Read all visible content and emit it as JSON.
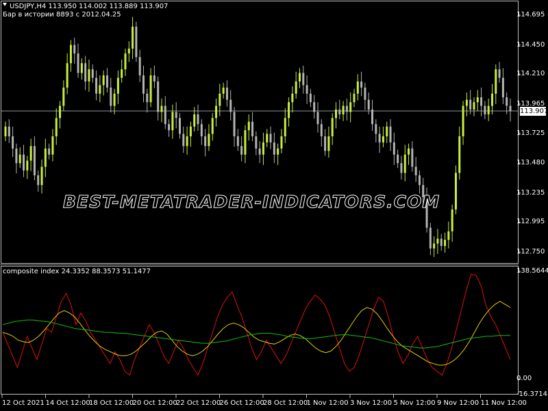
{
  "main_chart": {
    "header": "USDJPY,H4  113.950 114.002 113.889 113.907",
    "history": "Бар в истории 8893 с 2012.04.25",
    "watermark": "BEST-METATRADER-INDICATORS.COM",
    "current_price": "113.907",
    "price_labels": [
      "114.695",
      "114.450",
      "114.210",
      "113.965",
      "113.725",
      "113.480",
      "113.235",
      "112.995",
      "112.750"
    ]
  },
  "indicator": {
    "header": "composite index 24.3352 88.3573 51.1477",
    "axis_labels": [
      "138.5644",
      "0.00",
      "-16.3714"
    ]
  },
  "time_axis": [
    "12 Oct 2021",
    "14 Oct 12:00",
    "18 Oct 12:00",
    "20 Oct 12:00",
    "22 Oct 12:00",
    "26 Oct 12:00",
    "28 Oct 12:00",
    "1 Nov 12:00",
    "3 Nov 12:00",
    "5 Nov 12:00",
    "9 Nov 12:00",
    "11 Nov 12:00"
  ],
  "chart_data": [
    {
      "type": "candlestick",
      "symbol": "USDJPY",
      "timeframe": "H4",
      "ylim": [
        112.7,
        114.8
      ],
      "y_ticks": [
        114.695,
        114.45,
        114.21,
        113.965,
        113.725,
        113.48,
        113.235,
        112.995,
        112.75
      ],
      "current_price": 113.907,
      "bull_color": "#c8f03c",
      "bear_color": "#b4b4b4",
      "close": [
        113.78,
        113.7,
        113.6,
        113.48,
        113.55,
        113.42,
        113.5,
        113.62,
        113.38,
        113.3,
        113.45,
        113.6,
        113.55,
        113.7,
        113.85,
        113.95,
        114.1,
        114.3,
        114.45,
        114.38,
        114.22,
        114.3,
        114.15,
        114.25,
        114.18,
        114.05,
        114.12,
        114.2,
        114.1,
        113.95,
        114.05,
        114.18,
        114.25,
        114.38,
        114.42,
        114.6,
        114.35,
        114.2,
        114.05,
        113.98,
        114.2,
        114.15,
        113.9,
        113.95,
        113.8,
        113.75,
        113.9,
        113.85,
        113.72,
        113.62,
        113.7,
        113.78,
        113.88,
        113.8,
        113.7,
        113.62,
        113.72,
        113.85,
        113.95,
        114.05,
        114.1,
        114.0,
        113.9,
        113.7,
        113.62,
        113.55,
        113.75,
        113.82,
        113.7,
        113.6,
        113.55,
        113.65,
        113.72,
        113.65,
        113.55,
        113.6,
        113.7,
        113.85,
        113.98,
        114.05,
        114.15,
        114.22,
        114.12,
        114.05,
        113.98,
        113.9,
        113.8,
        113.7,
        113.58,
        113.7,
        113.85,
        113.92,
        113.88,
        113.95,
        113.9,
        113.98,
        114.05,
        114.15,
        114.1,
        114.0,
        113.92,
        113.8,
        113.72,
        113.65,
        113.7,
        113.78,
        113.65,
        113.55,
        113.48,
        113.4,
        113.55,
        113.6,
        113.45,
        113.38,
        113.3,
        113.2,
        112.95,
        112.78,
        112.82,
        112.86,
        112.8,
        112.85,
        112.92,
        113.1,
        113.4,
        113.7,
        113.95,
        114.0,
        113.92,
        113.98,
        114.02,
        113.95,
        113.88,
        113.95,
        114.05,
        114.25,
        114.18,
        114.02,
        113.95,
        113.907
      ],
      "open": [
        113.7,
        113.78,
        113.7,
        113.6,
        113.48,
        113.55,
        113.42,
        113.5,
        113.62,
        113.38,
        113.3,
        113.45,
        113.6,
        113.55,
        113.7,
        113.85,
        113.95,
        114.1,
        114.3,
        114.45,
        114.38,
        114.22,
        114.3,
        114.15,
        114.25,
        114.18,
        114.05,
        114.12,
        114.2,
        114.1,
        113.95,
        114.05,
        114.18,
        114.25,
        114.38,
        114.42,
        114.6,
        114.35,
        114.2,
        114.05,
        113.98,
        114.2,
        114.15,
        113.9,
        113.95,
        113.8,
        113.75,
        113.9,
        113.85,
        113.72,
        113.62,
        113.7,
        113.78,
        113.88,
        113.8,
        113.7,
        113.62,
        113.72,
        113.85,
        113.95,
        114.05,
        114.1,
        114.0,
        113.9,
        113.7,
        113.62,
        113.55,
        113.75,
        113.82,
        113.7,
        113.6,
        113.55,
        113.65,
        113.72,
        113.65,
        113.55,
        113.6,
        113.7,
        113.85,
        113.98,
        114.05,
        114.15,
        114.22,
        114.12,
        114.05,
        113.98,
        113.9,
        113.8,
        113.7,
        113.58,
        113.7,
        113.85,
        113.92,
        113.88,
        113.95,
        113.9,
        113.98,
        114.05,
        114.15,
        114.1,
        114.0,
        113.92,
        113.8,
        113.72,
        113.65,
        113.7,
        113.78,
        113.65,
        113.55,
        113.48,
        113.4,
        113.55,
        113.6,
        113.45,
        113.38,
        113.3,
        113.2,
        112.95,
        112.78,
        112.82,
        112.86,
        112.8,
        112.85,
        112.92,
        113.1,
        113.4,
        113.7,
        113.95,
        114.0,
        113.92,
        113.98,
        114.02,
        113.95,
        113.88,
        113.95,
        114.05,
        114.25,
        114.18,
        114.02,
        113.95
      ]
    },
    {
      "type": "line",
      "title": "composite index",
      "ylim": [
        -16.3714,
        138.5644
      ],
      "series": [
        {
          "name": "",
          "color": "#e01010",
          "values": [
            60,
            45,
            30,
            15,
            35,
            55,
            40,
            25,
            45,
            65,
            60,
            80,
            100,
            110,
            95,
            70,
            85,
            75,
            60,
            50,
            40,
            30,
            20,
            35,
            25,
            10,
            5,
            25,
            40,
            55,
            70,
            60,
            45,
            30,
            20,
            35,
            50,
            40,
            25,
            15,
            5,
            20,
            40,
            60,
            80,
            95,
            105,
            112,
            95,
            80,
            60,
            40,
            25,
            35,
            50,
            40,
            30,
            20,
            30,
            45,
            60,
            75,
            90,
            100,
            108,
            103,
            95,
            80,
            60,
            40,
            20,
            10,
            15,
            30,
            50,
            70,
            90,
            105,
            100,
            80,
            55,
            35,
            20,
            30,
            45,
            55,
            40,
            25,
            15,
            10,
            5,
            20,
            40,
            65,
            90,
            115,
            135,
            133,
            120,
            95,
            80,
            70,
            55,
            40,
            25
          ]
        },
        {
          "name": "",
          "color": "#e6d000",
          "values": [
            60,
            58,
            55,
            50,
            48,
            47,
            50,
            55,
            62,
            70,
            78,
            85,
            88,
            85,
            80,
            72,
            63,
            55,
            48,
            42,
            38,
            35,
            32,
            30,
            30,
            32,
            36,
            42,
            48,
            55,
            60,
            62,
            58,
            50,
            42,
            36,
            32,
            30,
            32,
            36,
            42,
            50,
            58,
            65,
            70,
            72,
            70,
            66,
            60,
            54,
            50,
            48,
            46,
            45,
            48,
            52,
            56,
            58,
            56,
            52,
            46,
            40,
            36,
            34,
            36,
            42,
            50,
            60,
            70,
            80,
            88,
            92,
            90,
            84,
            75,
            65,
            56,
            48,
            42,
            38,
            34,
            30,
            26,
            22,
            20,
            18,
            18,
            20,
            24,
            30,
            38,
            48,
            60,
            72,
            82,
            90,
            96,
            100,
            96,
            92
          ]
        },
        {
          "name": "",
          "color": "#10c010",
          "values": [
            70,
            72,
            74,
            75,
            76,
            76,
            75,
            74,
            73,
            71,
            69,
            67,
            65,
            64,
            63,
            62,
            61,
            60,
            60,
            59,
            59,
            58,
            57,
            56,
            55,
            54,
            53,
            52,
            51,
            50,
            49,
            48,
            47,
            46,
            46,
            47,
            48,
            49,
            51,
            53,
            55,
            57,
            58,
            59,
            59,
            58,
            57,
            55,
            54,
            53,
            52,
            52,
            53,
            54,
            55,
            56,
            57,
            57,
            56,
            55,
            54,
            53,
            51,
            49,
            47,
            45,
            43,
            42,
            41,
            40,
            40,
            41,
            42,
            44,
            46,
            48,
            50,
            52,
            53,
            54,
            55,
            55,
            56,
            56,
            56
          ]
        }
      ]
    }
  ]
}
